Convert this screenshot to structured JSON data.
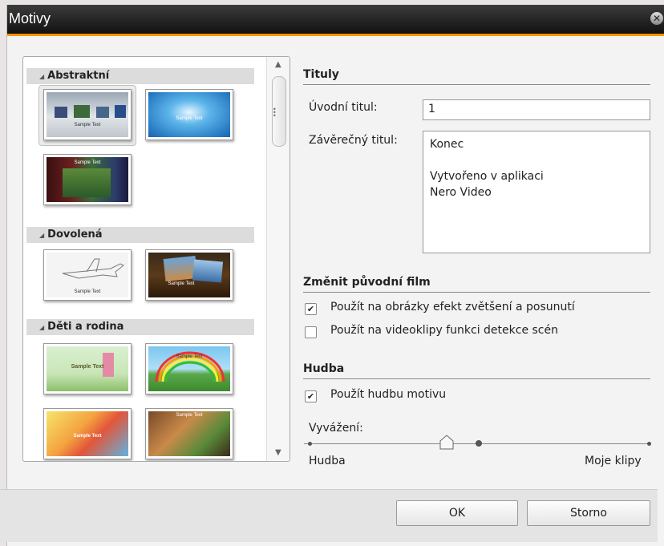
{
  "window": {
    "title": "Motivy"
  },
  "categories": [
    {
      "label": "Abstraktní"
    },
    {
      "label": "Dovolená"
    },
    {
      "label": "Děti a rodina"
    }
  ],
  "thumbnails": {
    "sample_text": "Sample Text"
  },
  "titles": {
    "heading": "Tituly",
    "opening_label": "Úvodní titul:",
    "opening_value": "1",
    "closing_label": "Závěrečný titul:",
    "closing_lines": [
      "Konec",
      "",
      "Vytvořeno v aplikaci",
      "Nero Video"
    ]
  },
  "movie": {
    "heading": "Změnit původní film",
    "option1_label": "Použít na obrázky efekt zvětšení a posunutí",
    "option1_checked": true,
    "option2_label": "Použít na videoklipy funkci detekce scén",
    "option2_checked": false
  },
  "music": {
    "heading": "Hudba",
    "use_label": "Použít hudbu motivu",
    "use_checked": true,
    "balance_label": "Vyvážení:",
    "left_label": "Hudba",
    "right_label": "Moje klipy"
  },
  "buttons": {
    "ok": "OK",
    "cancel": "Storno"
  }
}
